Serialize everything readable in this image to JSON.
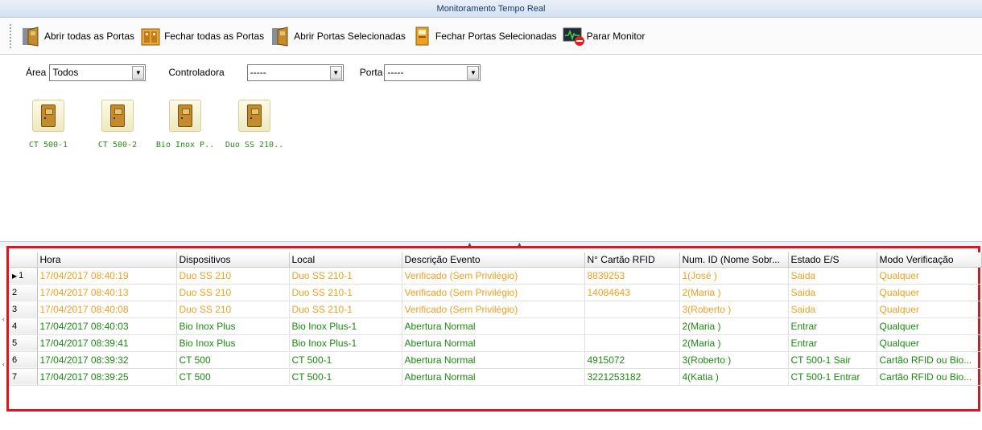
{
  "window": {
    "title": "Monitoramento Tempo Real"
  },
  "toolbar": {
    "buttons": [
      {
        "label": "Abrir todas as Portas",
        "icon": "open-door-icon"
      },
      {
        "label": "Fechar todas as Portas",
        "icon": "close-doors-icon"
      },
      {
        "label": "Abrir Portas Selecionadas",
        "icon": "open-door-icon"
      },
      {
        "label": "Fechar Portas Selecionadas",
        "icon": "closed-door-icon"
      },
      {
        "label": "Parar Monitor",
        "icon": "stop-monitor-icon"
      }
    ]
  },
  "filters": {
    "area_label": "Área",
    "area_value": "Todos",
    "controladora_label": "Controladora",
    "controladora_value": "-----",
    "porta_label": "Porta",
    "porta_value": "-----"
  },
  "devices": [
    {
      "name": "CT 500-1"
    },
    {
      "name": "CT 500-2"
    },
    {
      "name": "Bio Inox P.."
    },
    {
      "name": "Duo SS 210.."
    }
  ],
  "grid": {
    "columns": [
      "Hora",
      "Dispositivos",
      "Local",
      "Descrição Evento",
      "N° Cartão RFID",
      "Num. ID (Nome Sobr...",
      "Estado E/S",
      "Modo Verificação"
    ],
    "rows": [
      {
        "n": "1",
        "current": true,
        "cells": [
          "17/04/2017 08:40:19",
          "Duo SS 210",
          "Duo SS 210-1",
          "Verificado (Sem Privilégio)",
          "8839253",
          "1(José )",
          "Saida",
          "Qualquer"
        ],
        "style": "amber"
      },
      {
        "n": "2",
        "current": false,
        "cells": [
          "17/04/2017 08:40:13",
          "Duo SS 210",
          "Duo SS 210-1",
          "Verificado (Sem Privilégio)",
          "14084643",
          "2(Maria )",
          "Saida",
          "Qualquer"
        ],
        "style": "amber"
      },
      {
        "n": "3",
        "current": false,
        "cells": [
          "17/04/2017 08:40:08",
          "Duo SS 210",
          "Duo SS 210-1",
          "Verificado (Sem Privilégio)",
          "",
          "3(Roberto )",
          "Saida",
          "Qualquer"
        ],
        "style": "amber"
      },
      {
        "n": "4",
        "current": false,
        "cells": [
          "17/04/2017 08:40:03",
          "Bio Inox Plus",
          "Bio Inox Plus-1",
          "Abertura Normal",
          "",
          "2(Maria )",
          "Entrar",
          "Qualquer"
        ],
        "style": "green"
      },
      {
        "n": "5",
        "current": false,
        "cells": [
          "17/04/2017 08:39:41",
          "Bio Inox Plus",
          "Bio Inox Plus-1",
          "Abertura Normal",
          "",
          "2(Maria )",
          "Entrar",
          "Qualquer"
        ],
        "style": "green"
      },
      {
        "n": "6",
        "current": false,
        "cells": [
          "17/04/2017 08:39:32",
          "CT 500",
          "CT 500-1",
          "Abertura Normal",
          "4915072",
          "3(Roberto )",
          "CT 500-1 Sair",
          "Cartão RFID ou Bio..."
        ],
        "style": "green"
      },
      {
        "n": "7",
        "current": false,
        "cells": [
          "17/04/2017 08:39:25",
          "CT 500",
          "CT 500-1",
          "Abertura Normal",
          "3221253182",
          "4(Katia )",
          "CT 500-1 Entrar",
          "Cartão RFID ou Bio..."
        ],
        "style": "green"
      }
    ]
  },
  "colors": {
    "highlight_frame": "#e0141c",
    "amber_text": "#f0a020",
    "green_text": "#1d8a12"
  }
}
